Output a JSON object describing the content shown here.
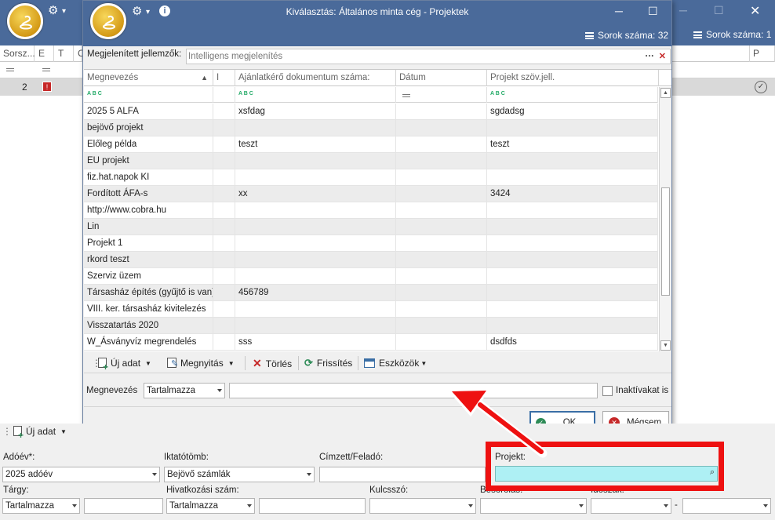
{
  "main": {
    "row_count": "Sorok száma: 1",
    "grid_headers": [
      "Sorsz...",
      "E",
      "T",
      "C",
      "P"
    ],
    "row_number": "2",
    "new_button": "Új adat"
  },
  "dialog": {
    "title": "Kiválasztás: Általános minta cég - Projektek",
    "row_count": "Sorok száma: 32",
    "features_label": "Megjelenített jellemzők:",
    "features_value": "Intelligens megjelenítés",
    "columns": [
      "Megnevezés",
      "I",
      "Ajánlatkérő dokumentum száma:",
      "Dátum",
      "Projekt szöv.jell."
    ],
    "rows": [
      {
        "name": "2025 5 ALFA",
        "doc": "xsfdag",
        "date": "",
        "desc": "sgdadsg"
      },
      {
        "name": "bejövő projekt",
        "doc": "",
        "date": "",
        "desc": ""
      },
      {
        "name": "Előleg példa",
        "doc": "teszt",
        "date": "",
        "desc": "teszt"
      },
      {
        "name": "EU projekt",
        "doc": "",
        "date": "",
        "desc": ""
      },
      {
        "name": "fiz.hat.napok KI",
        "doc": "",
        "date": "",
        "desc": ""
      },
      {
        "name": "Fordított ÁFA-s",
        "doc": "xx",
        "date": "",
        "desc": "3424"
      },
      {
        "name": "http://www.cobra.hu",
        "doc": "",
        "date": "",
        "desc": ""
      },
      {
        "name": "Lin",
        "doc": "",
        "date": "",
        "desc": ""
      },
      {
        "name": "Projekt 1",
        "doc": "",
        "date": "",
        "desc": ""
      },
      {
        "name": "rkord teszt",
        "doc": "",
        "date": "",
        "desc": ""
      },
      {
        "name": "Szerviz üzem",
        "doc": "",
        "date": "",
        "desc": ""
      },
      {
        "name": "Társasház építés (gyűjtő is van)",
        "doc": "456789",
        "date": "",
        "desc": ""
      },
      {
        "name": "VIII. ker. társasház kivitelezés",
        "doc": "",
        "date": "",
        "desc": ""
      },
      {
        "name": "Visszatartás 2020",
        "doc": "",
        "date": "",
        "desc": ""
      },
      {
        "name": "W_Ásványvíz megrendelés",
        "doc": "sss",
        "date": "",
        "desc": "dsdfds"
      }
    ],
    "toolbar": {
      "new": "Új adat",
      "open": "Megnyitás",
      "delete": "Törlés",
      "refresh": "Frissítés",
      "tools": "Eszközök"
    },
    "filter": {
      "label": "Megnevezés",
      "mode": "Tartalmazza",
      "value": "",
      "inactive_label": "Inaktívakat is"
    },
    "ok": "OK",
    "cancel": "Mégsem"
  },
  "form": {
    "adoev_label": "Adóév*:",
    "adoev_value": "2025 adóév",
    "iktato_label": "Iktatótömb:",
    "iktato_value": "Bejövő számlák",
    "cimzett_label": "Címzett/Feladó:",
    "projekt_label": "Projekt:",
    "targy_label": "Tárgy:",
    "targy_mode": "Tartalmazza",
    "hiv_label": "Hivatkozási szám:",
    "hiv_mode": "Tartalmazza",
    "kulcsszo_label": "Kulcsszó:",
    "besorolas_label": "Besorolás:",
    "idoszak_label": "Időszak:",
    "dash": "-"
  },
  "colors": {
    "titlebar": "#4a6a9a",
    "highlight": "#ee1111",
    "project_field": "#aef0f4"
  }
}
